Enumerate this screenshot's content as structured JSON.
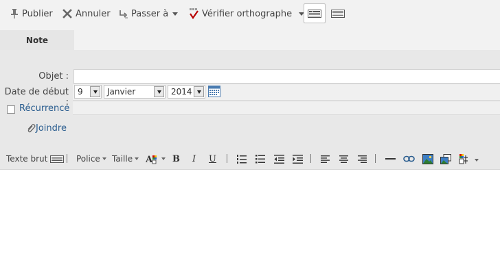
{
  "toolbar": {
    "publish_label": "Publier",
    "cancel_label": "Annuler",
    "goto_label": "Passer à",
    "spellcheck_label": "Vérifier orthographe"
  },
  "tabs": {
    "note_label": "Note"
  },
  "form": {
    "subject_label": "Objet :",
    "subject_value": "",
    "start_date_label": "Date de début :",
    "day": "9",
    "month": "Janvier",
    "year": "2014",
    "recurrence_label": "Récurrence",
    "attach_label": "Joindre"
  },
  "editor_toolbar": {
    "plain_text_label": "Texte brut",
    "font_label": "Police",
    "size_label": "Taille",
    "bold": "B",
    "italic": "I",
    "underline": "U"
  },
  "colors": {
    "toolbar_bg": "#f2f2f2",
    "form_bg": "#e8e8e8",
    "link": "#2a5d8f",
    "spell_check": "#b80000"
  }
}
